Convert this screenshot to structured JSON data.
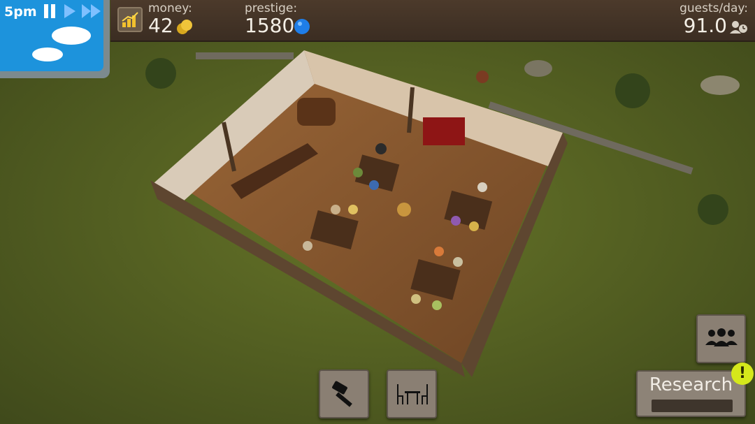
{
  "hud": {
    "time": "5pm",
    "controls": [
      "pause-icon",
      "play-icon",
      "fast-forward-icon"
    ],
    "money_label": "money:",
    "money_value": "42",
    "prestige_label": "prestige:",
    "prestige_value": "1580",
    "guests_label": "guests/day:",
    "guests_value": "91.0"
  },
  "toolbar": {
    "build_icon": "hammer-icon",
    "furniture_icon": "table-chairs-icon",
    "staff_icon": "group-icon",
    "research_label": "Research",
    "alert_symbol": "!"
  },
  "colors": {
    "sky": "#1d93dc",
    "panel": "#3f2f24",
    "prestige_gem": "#1f7ee8",
    "alert": "#d5e81b",
    "grass": "#566326"
  }
}
